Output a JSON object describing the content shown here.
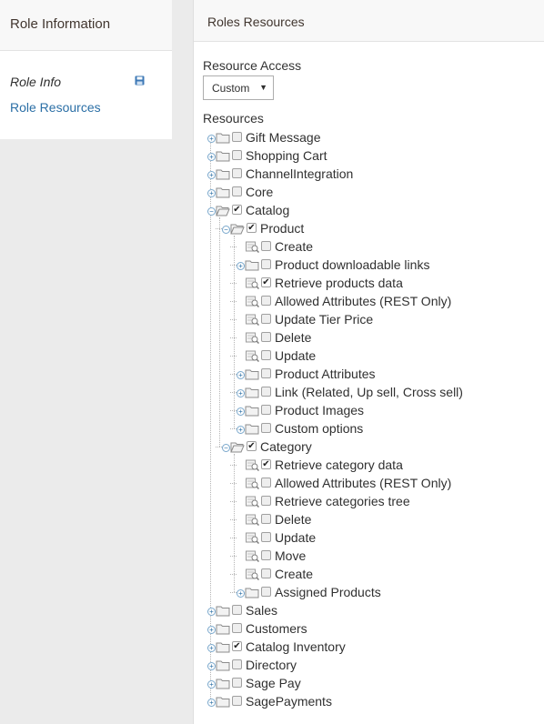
{
  "sidebar": {
    "title": "Role Information",
    "tabs": [
      {
        "label": "Role Info",
        "active": true
      },
      {
        "label": "Role Resources",
        "active": false
      }
    ],
    "save_icon": "floppy-disk-icon"
  },
  "panel": {
    "title": "Roles Resources",
    "access_label": "Resource Access",
    "access_value": "Custom",
    "resources_label": "Resources"
  },
  "colors": {
    "link": "#2b6fa6",
    "expander": "#2b6fa6"
  },
  "tree": [
    {
      "label": "Gift Message",
      "level": 0,
      "type": "folder",
      "expander": "plus",
      "checked": false
    },
    {
      "label": "Shopping Cart",
      "level": 0,
      "type": "folder",
      "expander": "plus",
      "checked": false
    },
    {
      "label": "ChannelIntegration",
      "level": 0,
      "type": "folder",
      "expander": "plus",
      "checked": false
    },
    {
      "label": "Core",
      "level": 0,
      "type": "folder",
      "expander": "plus",
      "checked": false
    },
    {
      "label": "Catalog",
      "level": 0,
      "type": "open-folder",
      "expander": "minus",
      "checked": true
    },
    {
      "label": "Product",
      "level": 1,
      "type": "open-folder",
      "expander": "minus",
      "checked": true
    },
    {
      "label": "Create",
      "level": 2,
      "type": "leaf",
      "expander": "none",
      "checked": false
    },
    {
      "label": "Product downloadable links",
      "level": 2,
      "type": "folder",
      "expander": "plus",
      "checked": false
    },
    {
      "label": "Retrieve products data",
      "level": 2,
      "type": "leaf",
      "expander": "none",
      "checked": true
    },
    {
      "label": "Allowed Attributes (REST Only)",
      "level": 2,
      "type": "leaf",
      "expander": "none",
      "checked": false
    },
    {
      "label": "Update Tier Price",
      "level": 2,
      "type": "leaf",
      "expander": "none",
      "checked": false
    },
    {
      "label": "Delete",
      "level": 2,
      "type": "leaf",
      "expander": "none",
      "checked": false
    },
    {
      "label": "Update",
      "level": 2,
      "type": "leaf",
      "expander": "none",
      "checked": false
    },
    {
      "label": "Product Attributes",
      "level": 2,
      "type": "folder",
      "expander": "plus",
      "checked": false
    },
    {
      "label": "Link (Related, Up sell, Cross sell)",
      "level": 2,
      "type": "folder",
      "expander": "plus",
      "checked": false
    },
    {
      "label": "Product Images",
      "level": 2,
      "type": "folder",
      "expander": "plus",
      "checked": false
    },
    {
      "label": "Custom options",
      "level": 2,
      "type": "folder",
      "expander": "plus",
      "checked": false
    },
    {
      "label": "Category",
      "level": 1,
      "type": "open-folder",
      "expander": "minus",
      "checked": true
    },
    {
      "label": "Retrieve category data",
      "level": 2,
      "type": "leaf",
      "expander": "none",
      "checked": true
    },
    {
      "label": "Allowed Attributes (REST Only)",
      "level": 2,
      "type": "leaf",
      "expander": "none",
      "checked": false
    },
    {
      "label": "Retrieve categories tree",
      "level": 2,
      "type": "leaf",
      "expander": "none",
      "checked": false
    },
    {
      "label": "Delete",
      "level": 2,
      "type": "leaf",
      "expander": "none",
      "checked": false
    },
    {
      "label": "Update",
      "level": 2,
      "type": "leaf",
      "expander": "none",
      "checked": false
    },
    {
      "label": "Move",
      "level": 2,
      "type": "leaf",
      "expander": "none",
      "checked": false
    },
    {
      "label": "Create",
      "level": 2,
      "type": "leaf",
      "expander": "none",
      "checked": false
    },
    {
      "label": "Assigned Products",
      "level": 2,
      "type": "folder",
      "expander": "plus",
      "checked": false
    },
    {
      "label": "Sales",
      "level": 0,
      "type": "folder",
      "expander": "plus",
      "checked": false
    },
    {
      "label": "Customers",
      "level": 0,
      "type": "folder",
      "expander": "plus",
      "checked": false
    },
    {
      "label": "Catalog Inventory",
      "level": 0,
      "type": "folder",
      "expander": "plus",
      "checked": true
    },
    {
      "label": "Directory",
      "level": 0,
      "type": "folder",
      "expander": "plus",
      "checked": false
    },
    {
      "label": "Sage Pay",
      "level": 0,
      "type": "folder",
      "expander": "plus",
      "checked": false
    },
    {
      "label": "SagePayments",
      "level": 0,
      "type": "folder",
      "expander": "plus",
      "checked": false
    }
  ]
}
